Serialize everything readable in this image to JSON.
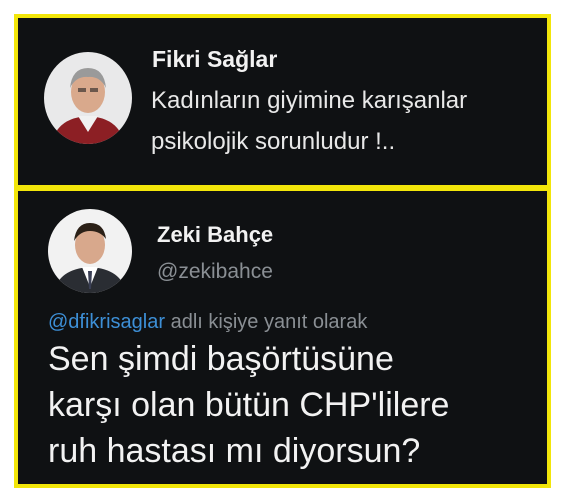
{
  "tweet1": {
    "author_name": "Fikri Sağlar",
    "lines": [
      "Kadınların giyimine karışanlar",
      "psikolojik sorunludur !.."
    ]
  },
  "tweet2": {
    "author_name": "Zeki Bahçe",
    "author_handle": "@zekibahce",
    "reply_mention": "@dfikrisaglar",
    "reply_suffix": " adlı kişiye yanıt olarak",
    "lines": [
      "Sen şimdi başörtüsüne",
      "karşı olan bütün CHP'lilere",
      "ruh hastası mı diyorsun?"
    ]
  },
  "colors": {
    "border": "#f2e60a",
    "background": "#0f1113",
    "mention": "#3d8fd6"
  }
}
